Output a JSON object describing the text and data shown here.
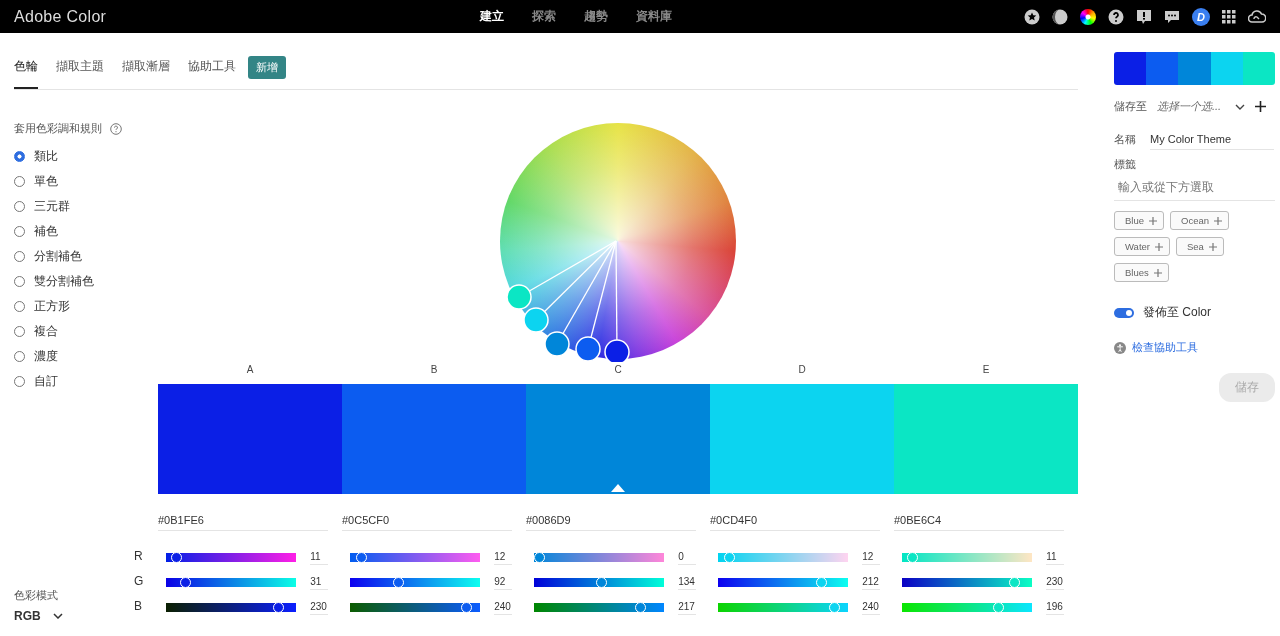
{
  "app": {
    "title": "Adobe Color",
    "avatar": "D"
  },
  "nav": [
    {
      "label": "建立",
      "selected": true
    },
    {
      "label": "探索",
      "selected": false
    },
    {
      "label": "趨勢",
      "selected": false
    },
    {
      "label": "資料庫",
      "selected": false
    }
  ],
  "tabs": [
    {
      "label": "色輪",
      "selected": true
    },
    {
      "label": "擷取主題",
      "selected": false
    },
    {
      "label": "擷取漸層",
      "selected": false
    },
    {
      "label": "協助工具",
      "selected": false
    }
  ],
  "new_badge": "新增",
  "harmony": {
    "title": "套用色彩調和規則",
    "rules": [
      {
        "label": "類比",
        "selected": true
      },
      {
        "label": "單色",
        "selected": false
      },
      {
        "label": "三元群",
        "selected": false
      },
      {
        "label": "補色",
        "selected": false
      },
      {
        "label": "分割補色",
        "selected": false
      },
      {
        "label": "雙分割補色",
        "selected": false
      },
      {
        "label": "正方形",
        "selected": false
      },
      {
        "label": "複合",
        "selected": false
      },
      {
        "label": "濃度",
        "selected": false
      },
      {
        "label": "自訂",
        "selected": false
      }
    ]
  },
  "color_mode": {
    "label": "色彩模式",
    "value": "RGB"
  },
  "channel_labels": [
    "R",
    "G",
    "B"
  ],
  "palette": [
    {
      "letter": "A",
      "color": "#0b1fe6",
      "hex": "#0B1FE6",
      "selected": false,
      "channels": [
        {
          "value": "11",
          "level": 0.043
        },
        {
          "value": "31",
          "level": 0.122
        },
        {
          "value": "230",
          "level": 0.902
        }
      ]
    },
    {
      "letter": "B",
      "color": "#0c5cf0",
      "hex": "#0C5CF0",
      "selected": false,
      "channels": [
        {
          "value": "12",
          "level": 0.047
        },
        {
          "value": "92",
          "level": 0.361
        },
        {
          "value": "240",
          "level": 0.941
        }
      ]
    },
    {
      "letter": "C",
      "color": "#0086d9",
      "hex": "#0086D9",
      "selected": true,
      "channels": [
        {
          "value": "0",
          "level": 0
        },
        {
          "value": "134",
          "level": 0.525
        },
        {
          "value": "217",
          "level": 0.851
        }
      ]
    },
    {
      "letter": "D",
      "color": "#0cd4f0",
      "hex": "#0CD4F0",
      "selected": false,
      "channels": [
        {
          "value": "12",
          "level": 0.047
        },
        {
          "value": "212",
          "level": 0.831
        },
        {
          "value": "240",
          "level": 0.941
        }
      ]
    },
    {
      "letter": "E",
      "color": "#0be6c4",
      "hex": "#0BE6C4",
      "selected": false,
      "channels": [
        {
          "value": "11",
          "level": 0.043
        },
        {
          "value": "230",
          "level": 0.902
        },
        {
          "value": "196",
          "level": 0.769
        }
      ]
    }
  ],
  "save_panel": {
    "save_to_label": "儲存至",
    "library_select": "选择一个选...",
    "name_label": "名稱",
    "name_value": "My Color Theme",
    "tags_label": "標籤",
    "tags_placeholder": "輸入或從下方選取",
    "tags": [
      "Blue",
      "Ocean",
      "Water",
      "Sea",
      "Blues"
    ],
    "publish": {
      "label": "發佈至 Color",
      "on": true
    },
    "accessibility_link": "檢查協助工具",
    "save_button": {
      "label": "儲存",
      "disabled": true
    }
  }
}
